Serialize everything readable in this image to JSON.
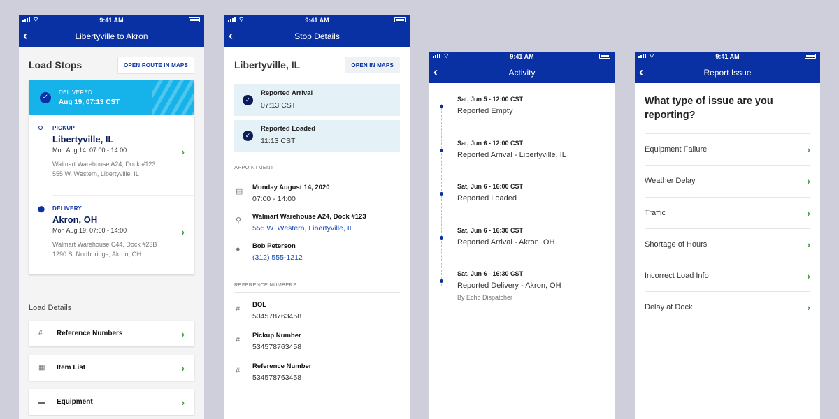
{
  "status_time": "9:41 AM",
  "screen1": {
    "nav_title": "Libertyville to Akron",
    "title": "Load Stops",
    "open_route_btn": "OPEN ROUTE IN MAPS",
    "delivered_label": "DELIVERED",
    "delivered_value": "Aug 19, 07:13 CST",
    "stops": [
      {
        "kind": "PICKUP",
        "city": "Libertyville, IL",
        "date": "Mon Aug 14, 07:00 - 14:00",
        "addr1": "Walmart Warehouse A24, Dock #123",
        "addr2": "555 W. Western, Libertyville, IL"
      },
      {
        "kind": "DELIVERY",
        "city": "Akron, OH",
        "date": "Mon Aug 19, 07:00 - 14:00",
        "addr1": "Walmart Warehouse C44, Dock #23B",
        "addr2": "1290 S. Northbridge, Akron, OH"
      }
    ],
    "details_label": "Load Details",
    "details": [
      {
        "icon": "hash-icon",
        "label": "Reference Numbers"
      },
      {
        "icon": "grid-icon",
        "label": "Item List"
      },
      {
        "icon": "truck-icon",
        "label": "Equipment"
      }
    ]
  },
  "screen2": {
    "nav_title": "Stop Details",
    "title": "Libertyville, IL",
    "open_maps_btn": "OPEN IN MAPS",
    "statuses": [
      {
        "label": "Reported Arrival",
        "time": "07:13 CST"
      },
      {
        "label": "Reported Loaded",
        "time": "11:13 CST"
      }
    ],
    "appointment_label": "APPOINTMENT",
    "appointment": {
      "date": "Monday August 14, 2020",
      "time": "07:00 - 14:00",
      "location_name": "Walmart Warehouse A24, Dock #123",
      "location_addr": "555 W. Western, Libertyville, IL",
      "contact_name": "Bob Peterson",
      "contact_phone": "(312) 555-1212"
    },
    "refs_label": "REFERENCE NUMBERS",
    "refs": [
      {
        "label": "BOL",
        "value": "534578763458"
      },
      {
        "label": "Pickup Number",
        "value": "534578763458"
      },
      {
        "label": "Reference Number",
        "value": "534578763458"
      }
    ]
  },
  "screen3": {
    "nav_title": "Activity",
    "items": [
      {
        "date": "Sat, Jun 5 - 12:00 CST",
        "event": "Reported Empty",
        "by": ""
      },
      {
        "date": "Sat, Jun 6 - 12:00 CST",
        "event": "Reported Arrival - Libertyville, IL",
        "by": ""
      },
      {
        "date": "Sat, Jun 6 - 16:00 CST",
        "event": "Reported Loaded",
        "by": ""
      },
      {
        "date": "Sat, Jun 6 - 16:30 CST",
        "event": "Reported Arrival - Akron, OH",
        "by": ""
      },
      {
        "date": "Sat, Jun 6 - 16:30 CST",
        "event": "Reported Delivery - Akron, OH",
        "by": "By Echo Dispatcher"
      }
    ]
  },
  "screen4": {
    "nav_title": "Report Issue",
    "question": "What type of issue are you reporting?",
    "issues": [
      "Equipment Failure",
      "Weather Delay",
      "Traffic",
      "Shortage of Hours",
      "Incorrect Load Info",
      "Delay at Dock"
    ]
  }
}
